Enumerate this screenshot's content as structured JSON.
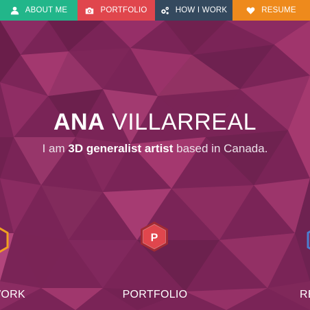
{
  "nav": {
    "items": [
      {
        "label": "ABOUT ME",
        "icon": "user-icon",
        "color": "#22b68a"
      },
      {
        "label": "PORTFOLIO",
        "icon": "camera-icon",
        "color": "#e0464d"
      },
      {
        "label": "HOW I WORK",
        "icon": "gears-icon",
        "color": "#34495e"
      },
      {
        "label": "RESUME",
        "icon": "heart-icon",
        "color": "#ee8a1c"
      }
    ]
  },
  "hero": {
    "first_name": "ANA",
    "last_name": "VILLARREAL",
    "tagline_prefix": "I am ",
    "tagline_emphasis": "3D generalist artist",
    "tagline_suffix": " based in Canada.",
    "background_color": "#7a2457"
  },
  "sections": {
    "left": {
      "label": "WORK",
      "badge_color": "#f0a020"
    },
    "center": {
      "label": "PORTFOLIO",
      "badge_letter": "P",
      "badge_color": "#e0464d"
    },
    "right": {
      "label": "RE",
      "badge_color": "#4a7fd0"
    }
  }
}
